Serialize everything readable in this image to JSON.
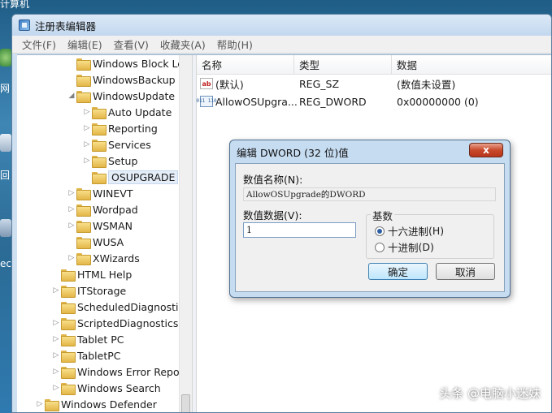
{
  "desktop": {
    "corner_label": "计算机",
    "side_labels": [
      "网",
      "回",
      "ec"
    ]
  },
  "window": {
    "title": "注册表编辑器"
  },
  "menu": [
    "文件(F)",
    "编辑(E)",
    "查看(V)",
    "收藏夹(A)",
    "帮助(H)"
  ],
  "tree": {
    "items": [
      {
        "label": "Windows Block Le",
        "arrow": "",
        "level": 2
      },
      {
        "label": "WindowsBackup",
        "arrow": "",
        "level": 2
      },
      {
        "label": "WindowsUpdate",
        "arrow": "◢",
        "level": 2
      },
      {
        "label": "Auto Update",
        "arrow": "▷",
        "level": 3
      },
      {
        "label": "Reporting",
        "arrow": "▷",
        "level": 3
      },
      {
        "label": "Services",
        "arrow": "▷",
        "level": 3
      },
      {
        "label": "Setup",
        "arrow": "▷",
        "level": 3
      },
      {
        "label": "OSUPGRADE",
        "arrow": "",
        "level": 3,
        "selected": true
      },
      {
        "label": "WINEVT",
        "arrow": "▷",
        "level": 2
      },
      {
        "label": "Wordpad",
        "arrow": "▷",
        "level": 2
      },
      {
        "label": "WSMAN",
        "arrow": "▷",
        "level": 2
      },
      {
        "label": "WUSA",
        "arrow": "",
        "level": 2
      },
      {
        "label": "XWizards",
        "arrow": "▷",
        "level": 2
      },
      {
        "label": "HTML Help",
        "arrow": "",
        "level": 1
      },
      {
        "label": "ITStorage",
        "arrow": "▷",
        "level": 1
      },
      {
        "label": "ScheduledDiagnostics",
        "arrow": "",
        "level": 1
      },
      {
        "label": "ScriptedDiagnosticsP",
        "arrow": "▷",
        "level": 1
      },
      {
        "label": "Tablet PC",
        "arrow": "▷",
        "level": 1
      },
      {
        "label": "TabletPC",
        "arrow": "▷",
        "level": 1
      },
      {
        "label": "Windows Error Repo",
        "arrow": "▷",
        "level": 1
      },
      {
        "label": "Windows Search",
        "arrow": "▷",
        "level": 1
      },
      {
        "label": "Windows Defender",
        "arrow": "▷",
        "level": 0
      }
    ]
  },
  "values": {
    "headers": {
      "name": "名称",
      "type": "类型",
      "data": "数据"
    },
    "rows": [
      {
        "icon": "string-value-icon",
        "icon_text": "ab",
        "name": "(默认)",
        "type": "REG_SZ",
        "data": "(数值未设置)"
      },
      {
        "icon": "binary-value-icon",
        "icon_text": "011\n110",
        "name": "AllowOSUpgra...",
        "type": "REG_DWORD",
        "data": "0x00000000 (0)"
      }
    ]
  },
  "dialog": {
    "title": "编辑 DWORD (32 位)值",
    "close_label": "x",
    "name_label": "数值名称",
    "name_key": "(N):",
    "name_value": "AllowOSUpgrade的DWORD",
    "data_label": "数值数据",
    "data_key": "(V):",
    "data_value": "1",
    "base_legend": "基数",
    "radio_hex": "十六进制",
    "radio_hex_key": "(H)",
    "radio_dec": "十进制",
    "radio_dec_key": "(D)",
    "selected_base": "hex",
    "ok_label": "确定",
    "cancel_label": "取消"
  },
  "watermark": "头条 @电脑小迷妹"
}
